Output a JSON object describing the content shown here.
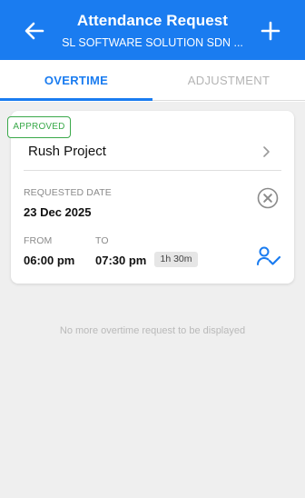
{
  "header": {
    "title": "Attendance Request",
    "subtitle": "SL SOFTWARE SOLUTION SDN ...",
    "back_icon": "arrow-left-icon",
    "add_icon": "plus-icon"
  },
  "tabs": [
    {
      "label": "OVERTIME",
      "active": true
    },
    {
      "label": "ADJUSTMENT",
      "active": false
    }
  ],
  "request": {
    "status": "APPROVED",
    "project": "Rush Project",
    "requested_date_label": "REQUESTED DATE",
    "requested_date": "23 Dec 2025",
    "from_label": "FROM",
    "from": "06:00 pm",
    "to_label": "TO",
    "to": "07:30 pm",
    "duration": "1h 30m"
  },
  "empty_message": "No more overtime request to be displayed",
  "colors": {
    "primary": "#1a7cf0",
    "approved": "#3aa94a",
    "background": "#efefef"
  }
}
